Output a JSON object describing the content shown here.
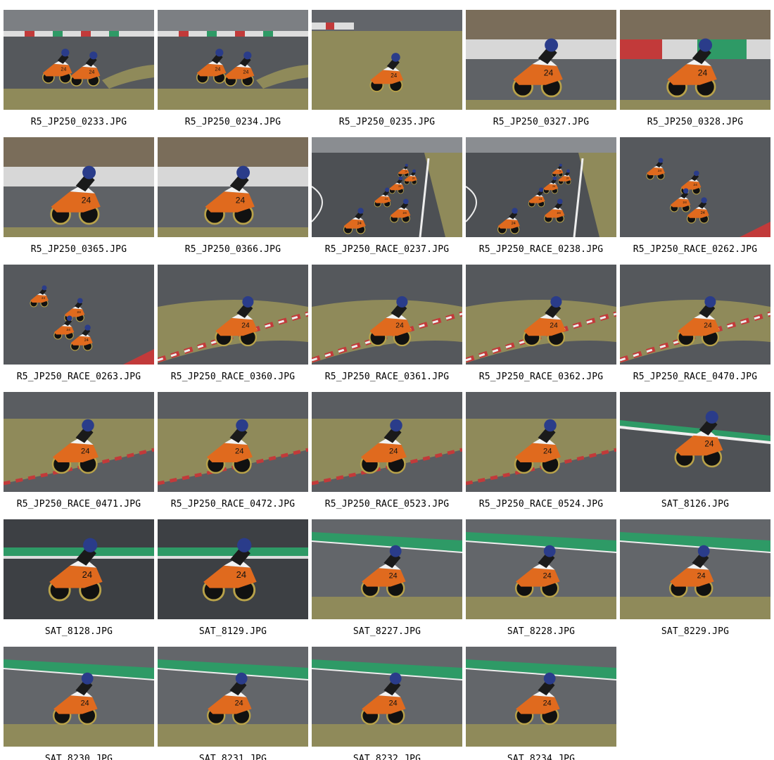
{
  "gallery": {
    "photos": [
      {
        "filename": "R5_JP250_0233.JPG",
        "scene": "two-riders-wide-curve"
      },
      {
        "filename": "R5_JP250_0234.JPG",
        "scene": "two-riders-wide-curve"
      },
      {
        "filename": "R5_JP250_0235.JPG",
        "scene": "single-rider-grass"
      },
      {
        "filename": "R5_JP250_0327.JPG",
        "scene": "rider-closeup-barrier"
      },
      {
        "filename": "R5_JP250_0328.JPG",
        "scene": "rider-closeup-barrier-red"
      },
      {
        "filename": "R5_JP250_0365.JPG",
        "scene": "rider-closeup-barrier"
      },
      {
        "filename": "R5_JP250_0366.JPG",
        "scene": "rider-closeup-barrier"
      },
      {
        "filename": "R5_JP250_RACE_0237.JPG",
        "scene": "pack-straight"
      },
      {
        "filename": "R5_JP250_RACE_0238.JPG",
        "scene": "pack-straight"
      },
      {
        "filename": "R5_JP250_RACE_0262.JPG",
        "scene": "group-asphalt"
      },
      {
        "filename": "R5_JP250_RACE_0263.JPG",
        "scene": "group-asphalt"
      },
      {
        "filename": "R5_JP250_RACE_0360.JPG",
        "scene": "rider-kerb-lean"
      },
      {
        "filename": "R5_JP250_RACE_0361.JPG",
        "scene": "rider-kerb-lean"
      },
      {
        "filename": "R5_JP250_RACE_0362.JPG",
        "scene": "rider-kerb-lean"
      },
      {
        "filename": "R5_JP250_RACE_0470.JPG",
        "scene": "rider-kerb-lean"
      },
      {
        "filename": "R5_JP250_RACE_0471.JPG",
        "scene": "rider-grass-lean"
      },
      {
        "filename": "R5_JP250_RACE_0472.JPG",
        "scene": "rider-grass-lean"
      },
      {
        "filename": "R5_JP250_RACE_0523.JPG",
        "scene": "rider-grass-lean"
      },
      {
        "filename": "R5_JP250_RACE_0524.JPG",
        "scene": "rider-grass-lean"
      },
      {
        "filename": "SAT_8126.JPG",
        "scene": "rider-green-kerb"
      },
      {
        "filename": "SAT_8128.JPG",
        "scene": "rider-dark-big"
      },
      {
        "filename": "SAT_8129.JPG",
        "scene": "rider-dark-big"
      },
      {
        "filename": "SAT_8227.JPG",
        "scene": "rider-green-line"
      },
      {
        "filename": "SAT_8228.JPG",
        "scene": "rider-green-line"
      },
      {
        "filename": "SAT_8229.JPG",
        "scene": "rider-green-line"
      },
      {
        "filename": "SAT_8230.JPG",
        "scene": "rider-green-line"
      },
      {
        "filename": "SAT_8231.JPG",
        "scene": "rider-green-line"
      },
      {
        "filename": "SAT_8232.JPG",
        "scene": "rider-green-line"
      },
      {
        "filename": "SAT_8234.JPG",
        "scene": "rider-green-line"
      }
    ]
  },
  "colors": {
    "asphalt": "#55585c",
    "grass": "#8f8a5a",
    "bike_orange": "#e06a1e",
    "kerb_red": "#c23a3a",
    "kerb_green": "#2e9a66"
  }
}
